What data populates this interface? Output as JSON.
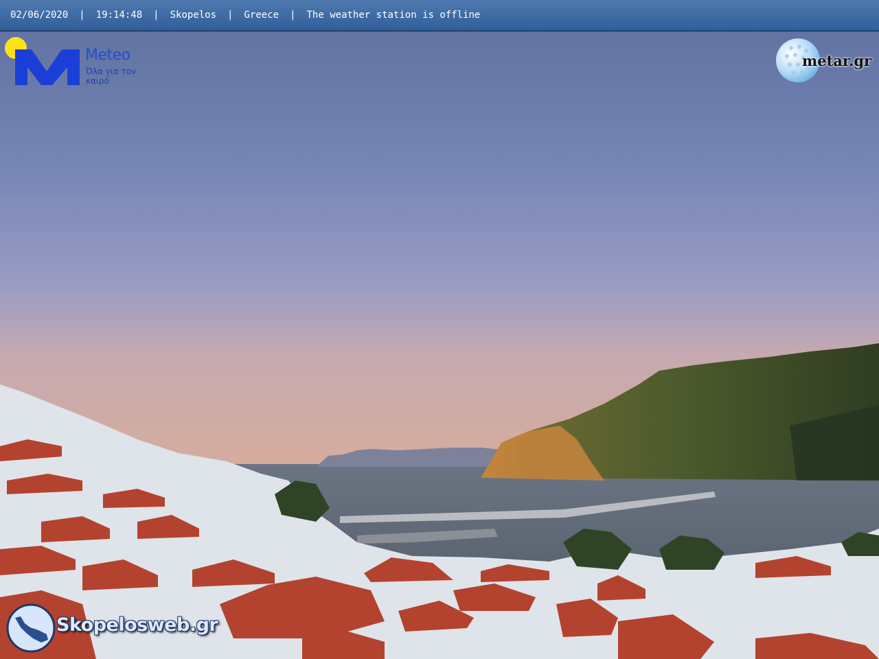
{
  "status_bar": {
    "date": "02/06/2020",
    "time": "19:14:48",
    "location": "Skopelos",
    "country": "Greece",
    "station_status": "The weather station is offline",
    "separator": "|"
  },
  "logos": {
    "meteo": {
      "name": "Meteo",
      "slogan": "Όλα για τον καιρό",
      "icon": "meteo-sun-m-logo"
    },
    "metar": {
      "name": "metar.gr",
      "icon": "golf-ball-logo"
    },
    "skopelosweb": {
      "name": "Skopelosweb.gr",
      "icon": "skopelos-island-logo"
    }
  },
  "scene": {
    "description_tag": "webcam-view",
    "colors": {
      "sky_top": "#5f73a3",
      "sky_mid": "#8a93c4",
      "sky_horizon": "#cfa9a3",
      "sea": "#5b6573",
      "hill": "#4f5a2f",
      "roof": "#b5412c",
      "wall": "#e6e8ec"
    }
  }
}
